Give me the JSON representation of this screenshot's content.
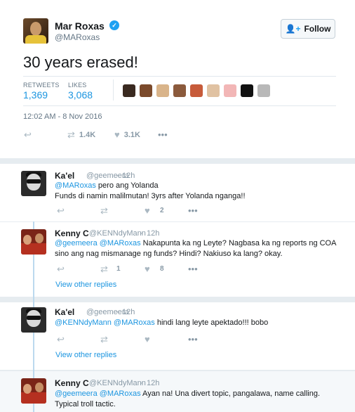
{
  "tweet": {
    "name": "Mar Roxas",
    "handle": "@MARoxas",
    "follow_label": "Follow",
    "text": "30 years erased!",
    "retweets_label": "RETWEETS",
    "retweets": "1,369",
    "likes_label": "LIKES",
    "likes": "3,068",
    "timestamp": "12:02 AM - 8 Nov 2016",
    "actions": {
      "retweet_count": "1.4K",
      "like_count": "3.1K"
    }
  },
  "replies": [
    {
      "name": "Ka'el",
      "handle": "@geemeera",
      "time": "12h",
      "mention": "@MARoxas",
      "line1_rest": " pero ang Yolanda",
      "line2": "Funds di namin malilmutan! 3yrs after Yolanda nganga!!",
      "like_count": "2"
    },
    {
      "name": "Kenny C",
      "handle": "@KENNdyMann",
      "time": "12h",
      "mention": "@geemeera @MARoxas",
      "line1_rest": " Nakapunta ka ng Leyte? Nagbasa ka ng reports ng COA",
      "line2": "sino ang nag mismanage ng funds? Hindi? Nakiuso ka lang? okay.",
      "retweet_count": "1",
      "like_count": "8",
      "view_other": "View other replies"
    },
    {
      "name": "Ka'el",
      "handle": "@geemeera",
      "time": "12h",
      "mention": "@KENNdyMann @MARoxas",
      "line1_rest": " hindi lang leyte apektado!!! bobo",
      "view_other": "View other replies"
    },
    {
      "name": "Kenny C",
      "handle": "@KENNdyMann",
      "time": "12h",
      "mention": "@geemeera @MARoxas",
      "line1_rest": " Ayan na! Una divert topic, pangalawa, name calling.",
      "line2": "Typical troll tactic."
    }
  ],
  "icons": {
    "reply": "reply-icon",
    "retweet": "retweet-icon",
    "like": "heart-icon",
    "more": "more-icon",
    "verified": "verified-icon",
    "follow": "add-user-icon"
  },
  "colors": {
    "accent": "#1da1f2",
    "link": "#1b95e0",
    "muted": "#8899a6",
    "thread_line": "#bcd9ee",
    "background": "#e6ecf0"
  },
  "likers": [
    "#3a2a20",
    "#7b4a2b",
    "#d9b48a",
    "#8b5a3c",
    "#c75b3a",
    "#e0c2a2",
    "#f2b6b6",
    "#111111",
    "#b8b8b8"
  ]
}
